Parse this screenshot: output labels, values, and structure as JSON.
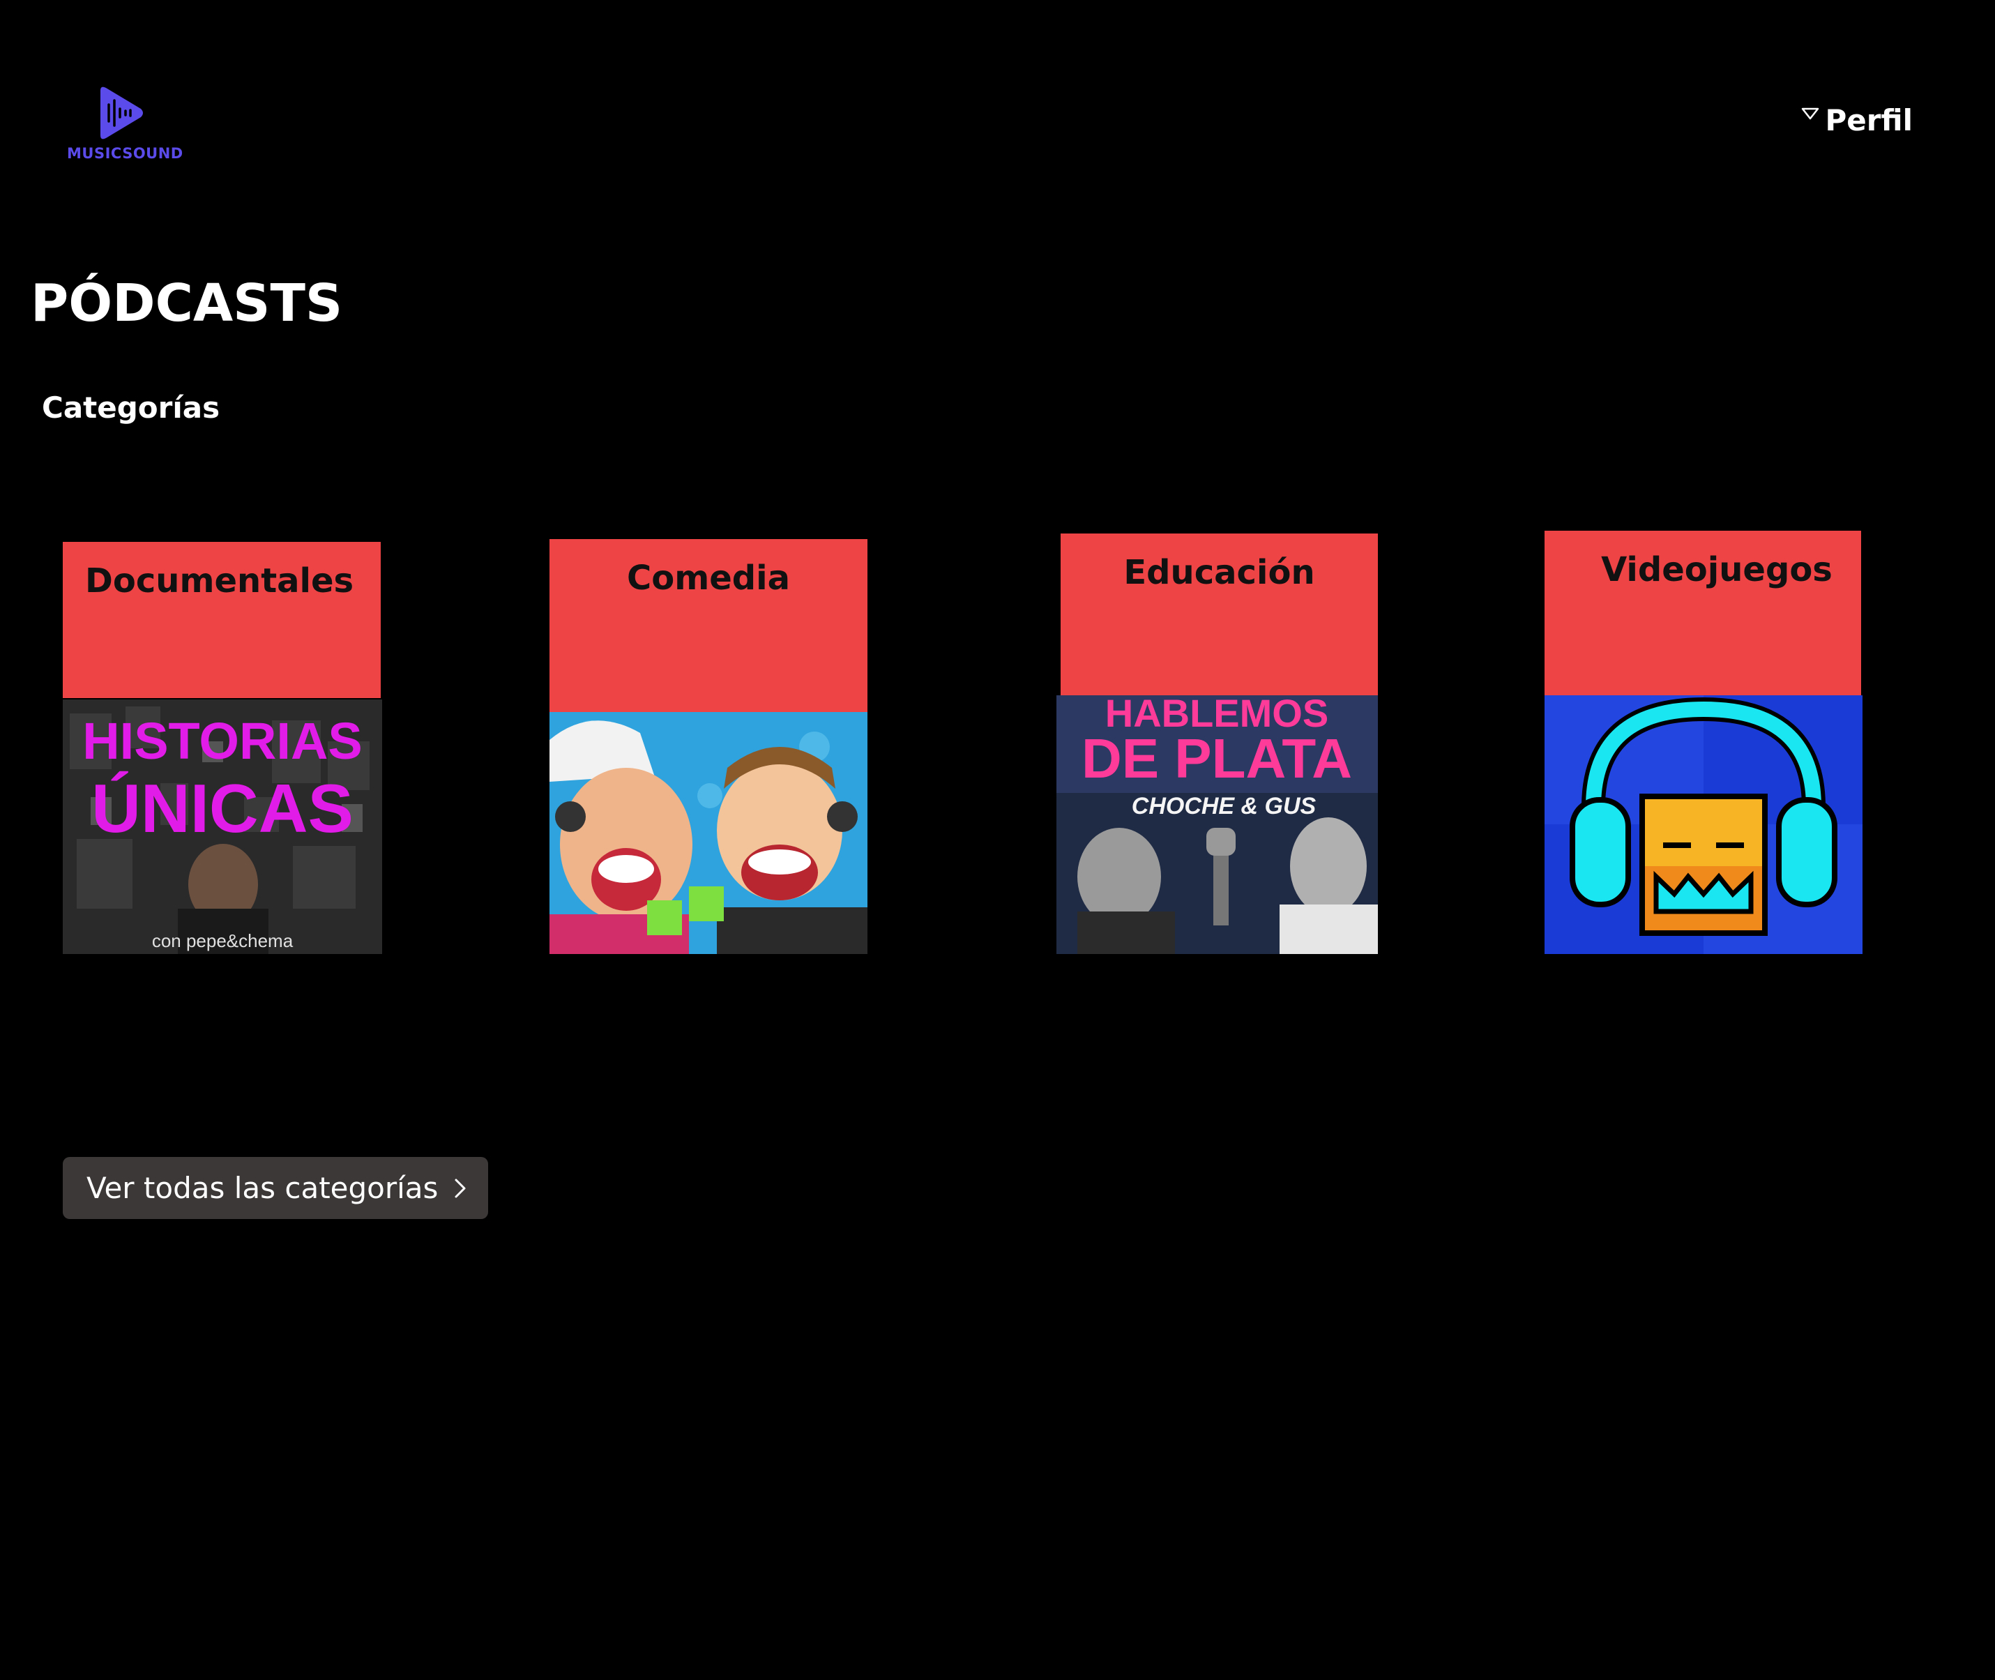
{
  "app": {
    "name": "MUSICSOUND",
    "logo_icon": "play-waveform-icon",
    "accent": "#5b4bea"
  },
  "header": {
    "profile_label": "Perfil",
    "profile_icon": "chevron-down-outline-icon"
  },
  "page": {
    "title": "PÓDCASTS",
    "section_title": "Categorías"
  },
  "categories": [
    {
      "label": "Documentales",
      "art": {
        "title_line1": "HISTORIAS",
        "title_line2": "ÚNICAS",
        "footer": "con pepe&chema"
      }
    },
    {
      "label": "Comedia",
      "art": {}
    },
    {
      "label": "Educación",
      "art": {
        "title_line1": "HABLEMOS",
        "title_line2": "DE PLATA",
        "subtitle": "CHOCHE & GUS"
      }
    },
    {
      "label": "Videojuegos",
      "art": {}
    }
  ],
  "card_color": "#ef4446",
  "cta": {
    "label": "Ver todas las categorías",
    "icon": "chevron-right-icon"
  }
}
